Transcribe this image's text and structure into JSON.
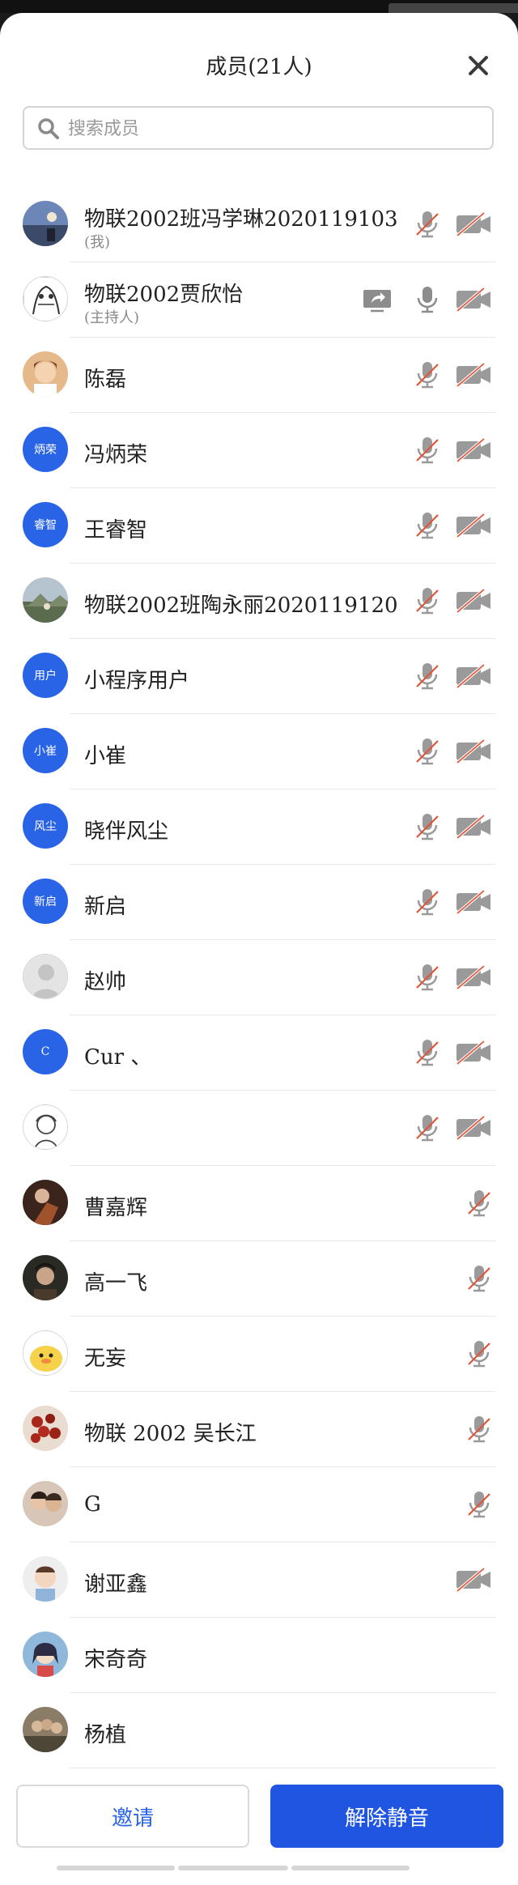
{
  "header": {
    "title": "成员(21人)"
  },
  "search": {
    "placeholder": "搜索成员"
  },
  "colors": {
    "accent": "#2a64e6",
    "button_primary": "#1f55e0",
    "muted_red": "#e0563b"
  },
  "members": [
    {
      "name": "物联2002班冯学琳2020119103",
      "sub": "(我)",
      "avatar": "photo-sky",
      "icons": [
        "mic-off",
        "cam-off"
      ]
    },
    {
      "name": "物联2002贾欣怡",
      "sub": "(主持人)",
      "avatar": "photo-sketch",
      "icons": [
        "share-screen",
        "mic-on",
        "cam-off"
      ]
    },
    {
      "name": "陈磊",
      "avatar": "photo-child",
      "icons": [
        "mic-off",
        "cam-off"
      ]
    },
    {
      "name": "冯炳荣",
      "avatar_text": "炳荣",
      "icons": [
        "mic-off",
        "cam-off"
      ]
    },
    {
      "name": "王睿智",
      "avatar_text": "睿智",
      "icons": [
        "mic-off",
        "cam-off"
      ]
    },
    {
      "name": "物联2002班陶永丽2020119120",
      "avatar": "photo-landscape",
      "icons": [
        "mic-off",
        "cam-off"
      ]
    },
    {
      "name": "小程序用户",
      "avatar_text": "用户",
      "icons": [
        "mic-off",
        "cam-off"
      ]
    },
    {
      "name": "小崔",
      "avatar_text": "小崔",
      "icons": [
        "mic-off",
        "cam-off"
      ]
    },
    {
      "name": "晓伴风尘",
      "avatar_text": "风尘",
      "icons": [
        "mic-off",
        "cam-off"
      ]
    },
    {
      "name": "新启",
      "avatar_text": "新启",
      "icons": [
        "mic-off",
        "cam-off"
      ]
    },
    {
      "name": "赵帅",
      "avatar": "default-person",
      "icons": [
        "mic-off",
        "cam-off"
      ]
    },
    {
      "name": "Cur 、",
      "avatar_text": "C",
      "icons": [
        "mic-off",
        "cam-off"
      ]
    },
    {
      "name": "",
      "avatar": "photo-doodle",
      "icons": [
        "mic-off",
        "cam-off"
      ]
    },
    {
      "name": "曹嘉辉",
      "avatar": "photo-guitar",
      "icons": [
        "mic-off"
      ]
    },
    {
      "name": "高一飞",
      "avatar": "photo-portrait",
      "icons": [
        "mic-off"
      ]
    },
    {
      "name": "无妄",
      "avatar": "photo-duck",
      "icons": [
        "mic-off"
      ]
    },
    {
      "name": "物联 2002 吴长江",
      "avatar": "photo-berries",
      "icons": [
        "mic-off"
      ]
    },
    {
      "name": "G",
      "avatar": "photo-couple",
      "icons": [
        "mic-off"
      ]
    },
    {
      "name": "谢亚鑫",
      "avatar": "photo-baby",
      "icons": [
        "cam-off"
      ]
    },
    {
      "name": "宋奇奇",
      "avatar": "photo-anime",
      "icons": []
    },
    {
      "name": "杨植",
      "avatar": "photo-group",
      "icons": []
    }
  ],
  "footer": {
    "invite_label": "邀请",
    "unmute_label": "解除静音"
  }
}
